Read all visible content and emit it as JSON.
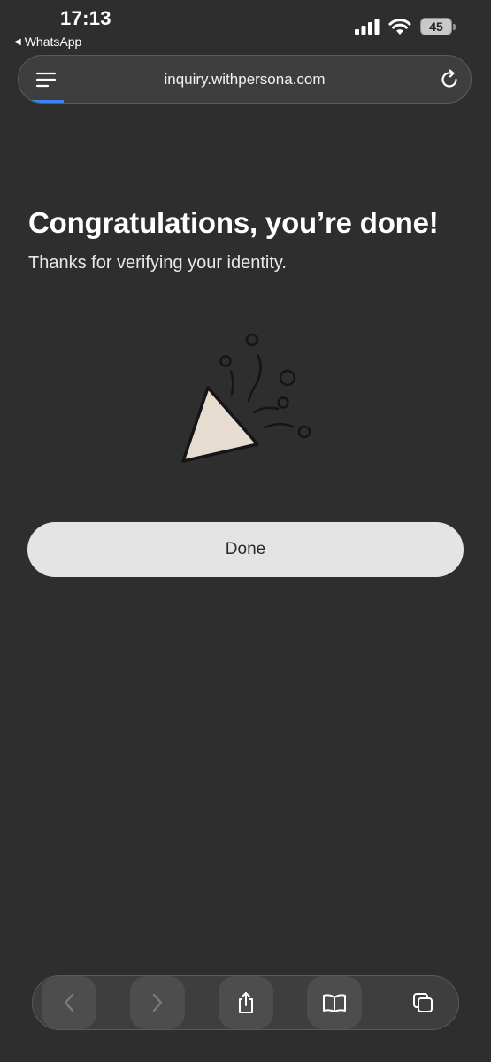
{
  "status_bar": {
    "time": "17:13",
    "back_app": "WhatsApp",
    "battery_level": "45"
  },
  "browser": {
    "url": "inquiry.withpersona.com",
    "load_progress": 0.1
  },
  "main": {
    "title": "Congratulations, you’re done!",
    "subtitle": "Thanks for verifying your identity.",
    "illustration": "party-popper-icon",
    "done_label": "Done"
  },
  "toolbar": {
    "items": [
      "back-icon",
      "forward-icon",
      "share-icon",
      "bookmarks-icon",
      "tabs-icon"
    ]
  },
  "colors": {
    "background": "#2e2e2e",
    "button_background": "#e4e4e4",
    "progress_accent": "#3a82f7"
  }
}
